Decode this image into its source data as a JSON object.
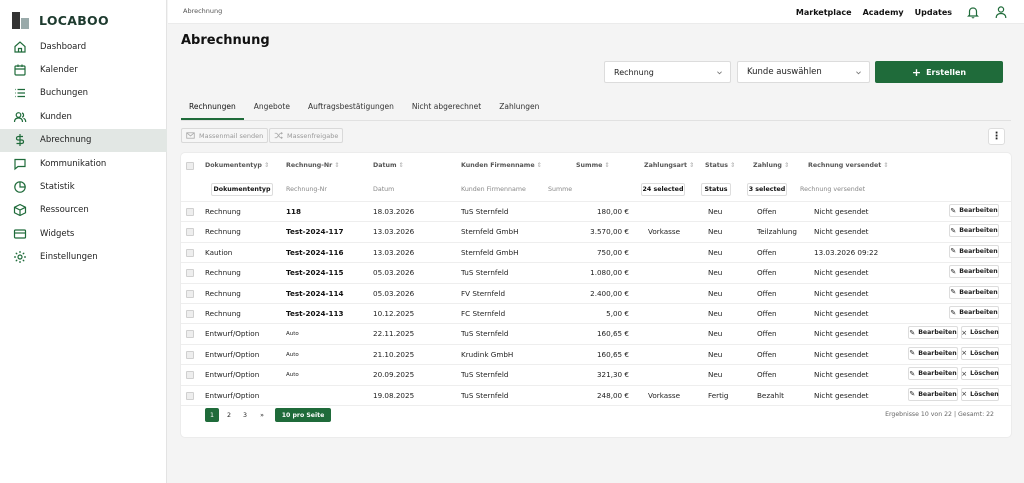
{
  "app": {
    "logo_text": "LOCABOO"
  },
  "sidebar": {
    "items": [
      {
        "label": "Dashboard",
        "icon": "home-icon"
      },
      {
        "label": "Kalender",
        "icon": "calendar-icon"
      },
      {
        "label": "Buchungen",
        "icon": "list-icon"
      },
      {
        "label": "Kunden",
        "icon": "users-icon"
      },
      {
        "label": "Abrechnung",
        "icon": "dollar-icon",
        "active": true
      },
      {
        "label": "Kommunikation",
        "icon": "message-icon"
      },
      {
        "label": "Statistik",
        "icon": "pie-chart-icon"
      },
      {
        "label": "Ressourcen",
        "icon": "box-icon"
      },
      {
        "label": "Widgets",
        "icon": "card-icon"
      },
      {
        "label": "Einstellungen",
        "icon": "gear-icon"
      }
    ]
  },
  "topbar": {
    "breadcrumb": "Abrechnung",
    "links": [
      "Marketplace",
      "Academy",
      "Updates"
    ]
  },
  "page": {
    "title": "Abrechnung"
  },
  "actions": {
    "type_select": "Rechnung",
    "customer_select": "Kunde auswählen",
    "create_label": "Erstellen"
  },
  "tabs": [
    "Rechnungen",
    "Angebote",
    "Auftragsbestätigungen",
    "Nicht abgerechnet",
    "Zahlungen"
  ],
  "toolbar": {
    "massmail": "Massenmail senden",
    "massrelease": "Massenfreigabe"
  },
  "table": {
    "columns": [
      "Dokumententyp",
      "Rechnung-Nr",
      "Datum",
      "Kunden Firmenname",
      "Summe",
      "Zahlungsart",
      "Status",
      "Zahlung",
      "Rechnung versendet"
    ],
    "filters": {
      "doctype": "Dokumententyp",
      "number": "Rechnung-Nr",
      "date": "Datum",
      "company": "Kunden Firmenname",
      "sum": "Summe",
      "payment_method": "24 selected",
      "status": "Status",
      "payment": "3 selected",
      "sent": "Rechnung versendet"
    },
    "rows": [
      {
        "type": "Rechnung",
        "number": "118",
        "date": "18.03.2026",
        "customer": "TuS Sternfeld",
        "sum": "180,00 €",
        "method": "",
        "status": "Neu",
        "payment": "Offen",
        "sent": "Nicht gesendet",
        "delete": false
      },
      {
        "type": "Rechnung",
        "number": "Test-2024-117",
        "date": "13.03.2026",
        "customer": "Sternfeld GmbH",
        "sum": "3.570,00 €",
        "method": "Vorkasse",
        "status": "Neu",
        "payment": "Teilzahlung",
        "sent": "Nicht gesendet",
        "delete": false
      },
      {
        "type": "Kaution",
        "number": "Test-2024-116",
        "date": "13.03.2026",
        "customer": "Sternfeld GmbH",
        "sum": "750,00 €",
        "method": "",
        "status": "Neu",
        "payment": "Offen",
        "sent": "13.03.2026 09:22",
        "delete": false
      },
      {
        "type": "Rechnung",
        "number": "Test-2024-115",
        "date": "05.03.2026",
        "customer": "TuS Sternfeld",
        "sum": "1.080,00 €",
        "method": "",
        "status": "Neu",
        "payment": "Offen",
        "sent": "Nicht gesendet",
        "delete": false
      },
      {
        "type": "Rechnung",
        "number": "Test-2024-114",
        "date": "05.03.2026",
        "customer": "FV Sternfeld",
        "sum": "2.400,00 €",
        "method": "",
        "status": "Neu",
        "payment": "Offen",
        "sent": "Nicht gesendet",
        "delete": false
      },
      {
        "type": "Rechnung",
        "number": "Test-2024-113",
        "date": "10.12.2025",
        "customer": "FC Sternfeld",
        "sum": "5,00 €",
        "method": "",
        "status": "Neu",
        "payment": "Offen",
        "sent": "Nicht gesendet",
        "delete": false
      },
      {
        "type": "Entwurf/Option",
        "number": "Auto",
        "date": "22.11.2025",
        "customer": "TuS Sternfeld",
        "sum": "160,65 €",
        "method": "",
        "status": "Neu",
        "payment": "Offen",
        "sent": "Nicht gesendet",
        "delete": true
      },
      {
        "type": "Entwurf/Option",
        "number": "Auto",
        "date": "21.10.2025",
        "customer": "Krudink GmbH",
        "sum": "160,65 €",
        "method": "",
        "status": "Neu",
        "payment": "Offen",
        "sent": "Nicht gesendet",
        "delete": true
      },
      {
        "type": "Entwurf/Option",
        "number": "Auto",
        "date": "20.09.2025",
        "customer": "TuS Sternfeld",
        "sum": "321,30 €",
        "method": "",
        "status": "Neu",
        "payment": "Offen",
        "sent": "Nicht gesendet",
        "delete": true
      },
      {
        "type": "Entwurf/Option",
        "number": "",
        "date": "19.08.2025",
        "customer": "TuS Sternfeld",
        "sum": "248,00 €",
        "method": "Vorkasse",
        "status": "Fertig",
        "payment": "Bezahlt",
        "sent": "Nicht gesendet",
        "delete": true
      }
    ],
    "edit_label": "Bearbeiten",
    "delete_label": "Löschen"
  },
  "pagination": {
    "pages": [
      "1",
      "2",
      "3",
      "»"
    ],
    "page_size": "10 pro Seite",
    "info": "Ergebnisse 10 von 22 | Gesamt: 22"
  },
  "colors": {
    "primary": "#1f6b3a",
    "active_nav": "#e2e7e4"
  }
}
